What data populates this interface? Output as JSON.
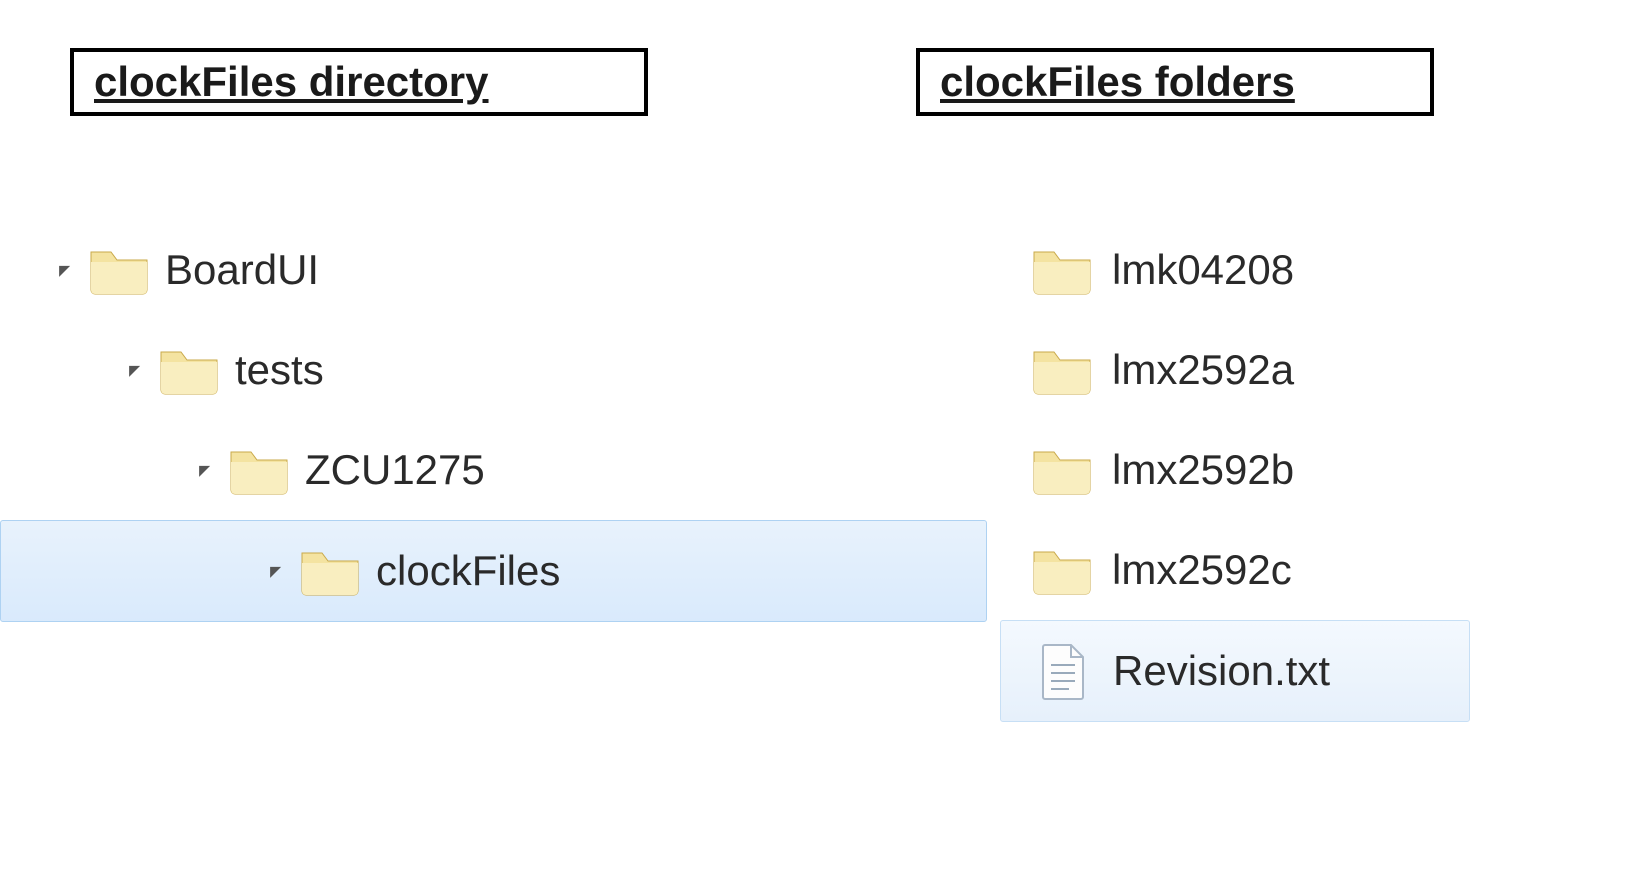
{
  "left": {
    "title": "clockFiles directory",
    "tree": [
      {
        "label": "BoardUI",
        "indent": 0,
        "selected": false
      },
      {
        "label": "tests",
        "indent": 1,
        "selected": false
      },
      {
        "label": "ZCU1275",
        "indent": 2,
        "selected": false
      },
      {
        "label": "clockFiles",
        "indent": 3,
        "selected": true
      }
    ]
  },
  "right": {
    "title": "clockFiles folders",
    "items": [
      {
        "label": "lmk04208",
        "type": "folder",
        "selected": false
      },
      {
        "label": "lmx2592a",
        "type": "folder",
        "selected": false
      },
      {
        "label": "lmx2592b",
        "type": "folder",
        "selected": false
      },
      {
        "label": "lmx2592c",
        "type": "folder",
        "selected": false
      },
      {
        "label": "Revision.txt",
        "type": "file",
        "selected": true
      }
    ]
  }
}
